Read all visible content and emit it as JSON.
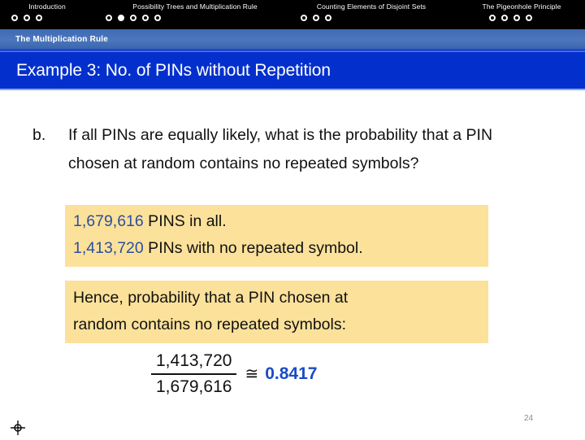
{
  "nav": {
    "sections": [
      {
        "label": "Introduction",
        "dots": 3,
        "active_index": -1
      },
      {
        "label": "Possibility Trees and Multiplication Rule",
        "dots": 5,
        "active_index": 1
      },
      {
        "label": "Counting Elements of Disjoint Sets",
        "dots": 3,
        "active_index": -1
      },
      {
        "label": "The Pigeonhole Principle",
        "dots": 4,
        "active_index": -1
      }
    ]
  },
  "subtitle": {
    "text": "The Multiplication Rule"
  },
  "title": {
    "text": "Example 3: No. of PINs without Repetition"
  },
  "question": {
    "marker": "b.",
    "text": "If all PINs are equally likely, what is the probability that a PIN chosen at random contains no repeated symbols?"
  },
  "answer_box": {
    "line1_number": "1,679,616",
    "line1_rest": " PINS in all.",
    "line2_number": "1,413,720",
    "line2_rest": " PINs with no repeated symbol."
  },
  "conclusion_box": {
    "line1": "Hence, probability that a PIN chosen at",
    "line2": "random contains no repeated symbols:"
  },
  "result": {
    "numerator": "1,413,720",
    "denominator": "1,679,616",
    "approx_symbol": "≅",
    "value": "0.8417"
  },
  "footer": {
    "page_number": "24",
    "icon": "crosshair-icon"
  },
  "colors": {
    "nav_background": "#000000",
    "subtitle_bar": "#4b77bd",
    "title_bar": "#0330cc",
    "highlight_yellow": "#fce19a",
    "number_blue": "#2b4f9e",
    "result_blue": "#1b4cc4",
    "page_number_gray": "#8a8a8a"
  }
}
